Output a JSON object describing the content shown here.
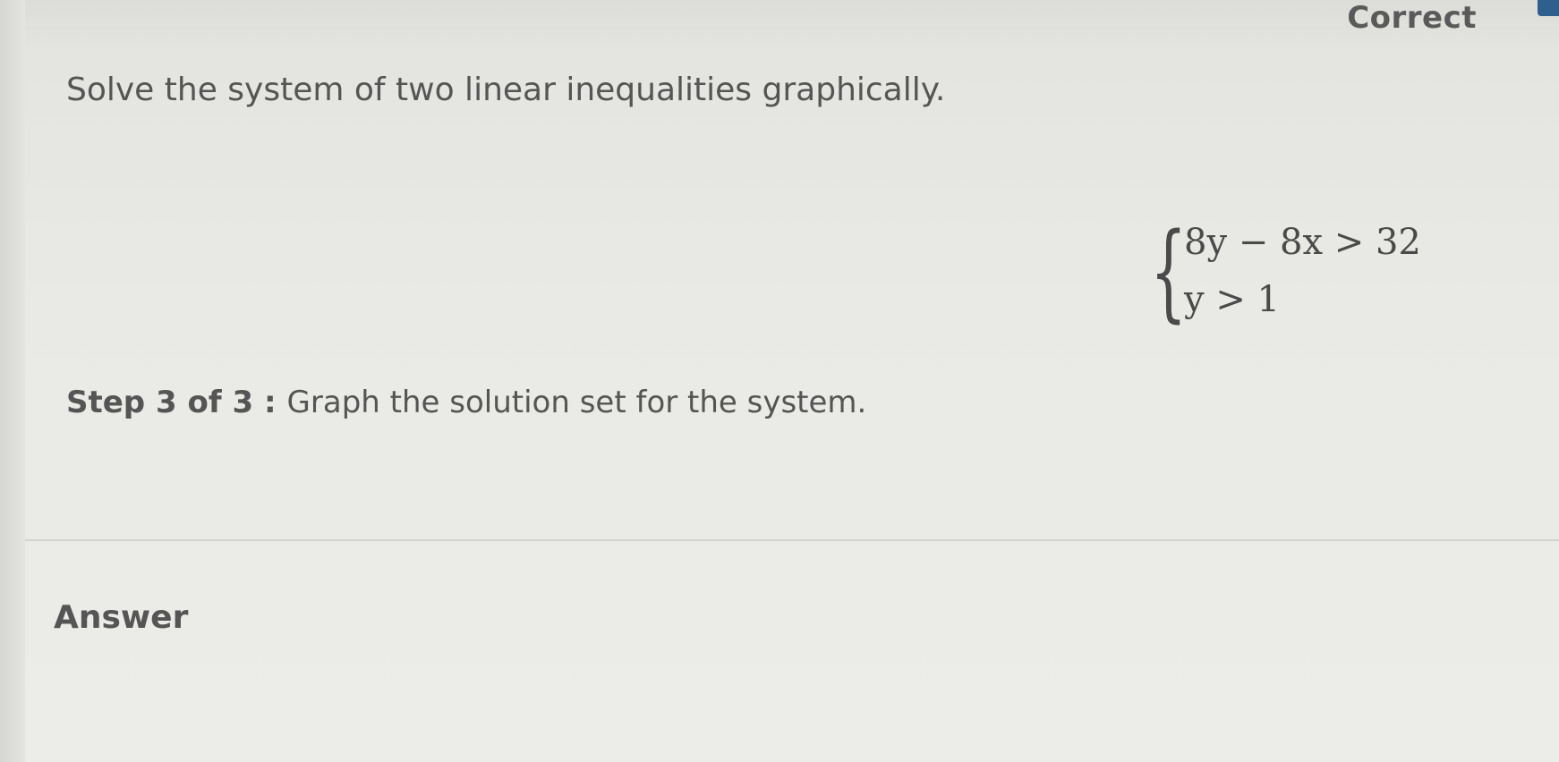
{
  "status": {
    "label": "Correct"
  },
  "question": {
    "prompt": "Solve the system of two linear inequalities graphically.",
    "system": [
      "8y − 8x > 32",
      "y > 1"
    ],
    "step_label": "Step 3 of 3 :",
    "step_text": "Graph the solution set for the system."
  },
  "answer": {
    "label": "Answer"
  },
  "colors": {
    "background": "#e9e9e5",
    "text": "#555555",
    "accent_tab": "#2f5f8c"
  }
}
